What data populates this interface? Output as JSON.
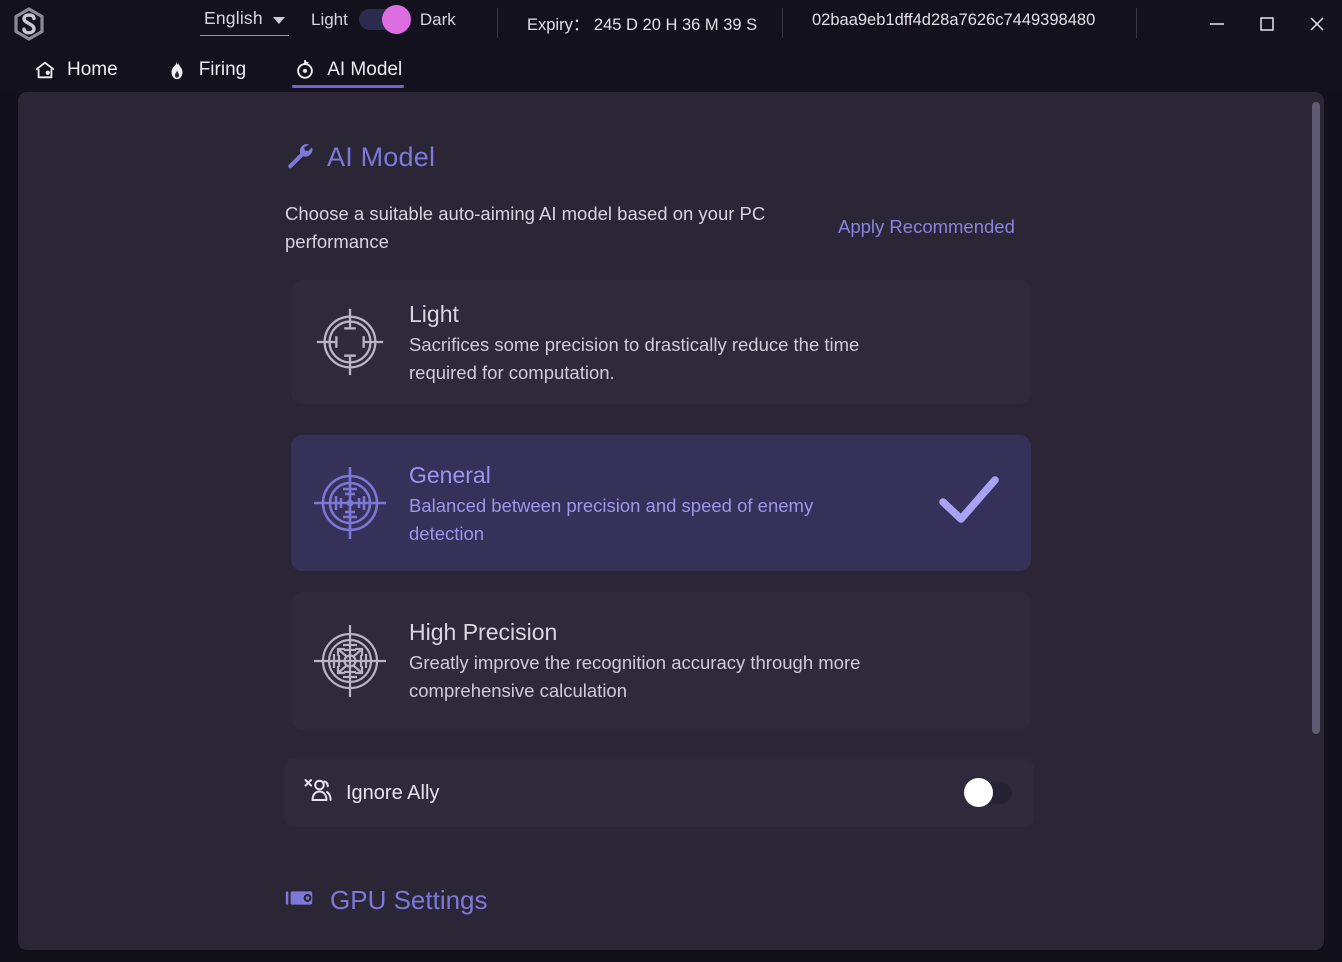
{
  "titlebar": {
    "logo_icon": "hexagon-s-logo",
    "language": {
      "value": "English",
      "caret_icon": "chevron-down-icon"
    },
    "theme": {
      "light_label": "Light",
      "dark_label": "Dark",
      "active": "Dark",
      "knob_color": "#dc6ee0",
      "track_color": "#2c2a4e"
    },
    "expiry_text": "Expiry： 245 D 20 H 36 M 39 S",
    "hwid": "02baa9eb1dff4d28a7626c7449398480",
    "window_controls": {
      "minimize": "minimize-icon",
      "maximize": "maximize-icon",
      "close": "close-icon"
    }
  },
  "tabs": [
    {
      "label": "Home",
      "icon": "home-icon",
      "active": false
    },
    {
      "label": "Firing",
      "icon": "flame-icon",
      "active": false
    },
    {
      "label": "AI Model",
      "icon": "crosshair-icon",
      "active": true
    }
  ],
  "main": {
    "section_icon": "wrench-icon",
    "section_title": "AI Model",
    "description": "Choose a suitable auto-aiming AI model based on your PC performance",
    "apply_recommended": "Apply Recommended",
    "models": [
      {
        "name": "Light",
        "description": "Sacrifices some precision to drastically reduce the time required for computation.",
        "icon": "target-simple-icon",
        "selected": false
      },
      {
        "name": "General",
        "description": "Balanced between precision and speed of enemy detection",
        "icon": "target-medium-icon",
        "selected": true,
        "check_icon": "check-icon"
      },
      {
        "name": "High Precision",
        "description": "Greatly improve the recognition accuracy through more comprehensive calculation",
        "icon": "target-detailed-icon",
        "selected": false
      }
    ],
    "ignore_ally": {
      "label": "Ignore Ally",
      "icon": "person-x-icon",
      "enabled": false
    },
    "gpu_settings": {
      "title": "GPU Settings",
      "icon": "gpu-card-icon"
    }
  },
  "colors": {
    "accent": "#7e78d8",
    "selected_card_bg": "#353159",
    "card_bg": "#2e2a3c",
    "panel_bg": "#2a2636",
    "window_bg": "#14111f",
    "toggle_on": "#dc6ee0"
  }
}
